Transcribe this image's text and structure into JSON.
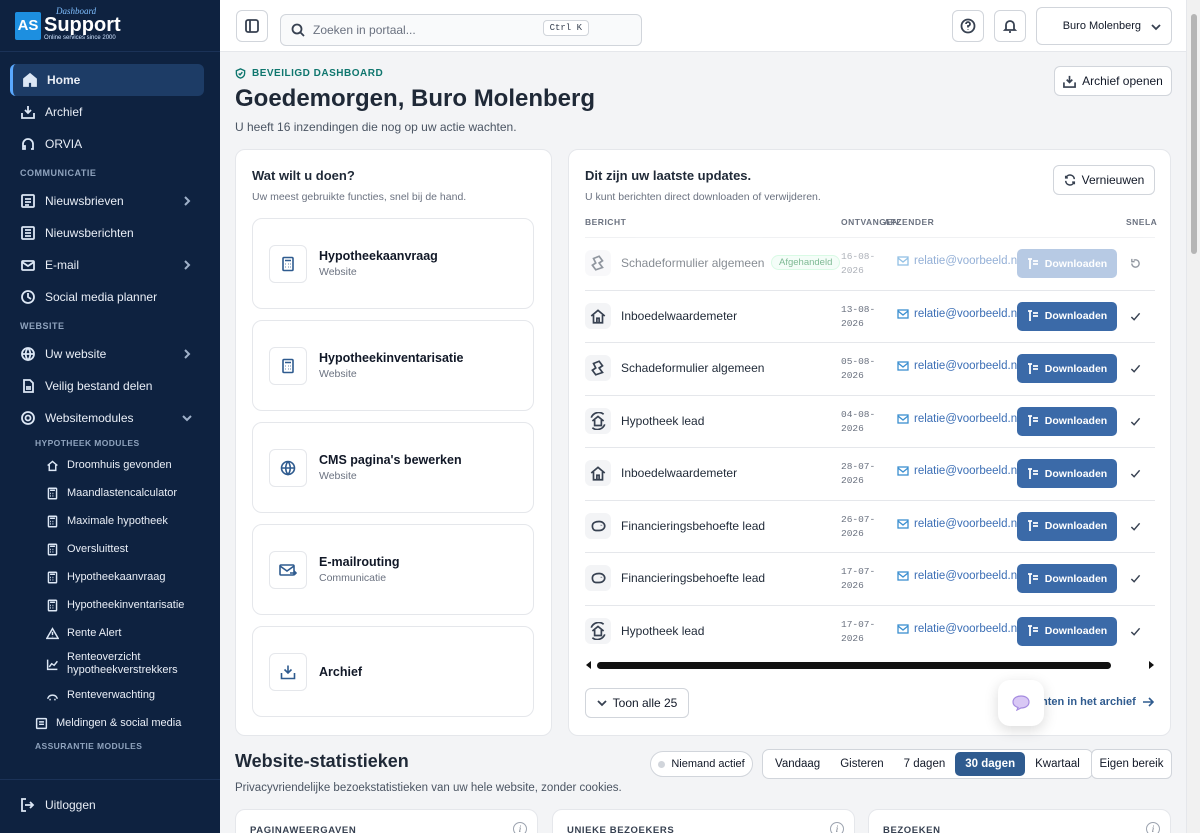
{
  "brand": {
    "logo_letters": "AS",
    "logo_small": "Dashboard",
    "logo_main": "Support",
    "logo_sub": "Online services since 2000"
  },
  "sidebar": {
    "items": [
      {
        "label": "Home"
      },
      {
        "label": "Archief"
      },
      {
        "label": "ORVIA"
      },
      {
        "section": "COMMUNICATIE"
      },
      {
        "label": "Nieuwsbrieven"
      },
      {
        "label": "Nieuwsberichten"
      },
      {
        "label": "E-mail"
      },
      {
        "label": "Social media planner"
      },
      {
        "section": "WEBSITE"
      },
      {
        "label": "Uw website"
      },
      {
        "label": "Veilig bestand delen"
      },
      {
        "label": "Websitemodules"
      }
    ],
    "hypotheek_section": "HYPOTHEEK MODULES",
    "hypotheek_items": [
      "Droomhuis gevonden",
      "Maandlastencalculator",
      "Maximale hypotheek",
      "Oversluittest",
      "Hypotheekaanvraag",
      "Hypotheekinventarisatie",
      "Rente Alert",
      "Renteoverzicht hypotheekverstrekkers",
      "Renteverwachting"
    ],
    "meldingen": "Meldingen & social media",
    "assurantie_section": "ASSURANTIE MODULES",
    "logout": "Uitloggen"
  },
  "topbar": {
    "search_placeholder": "Zoeken in portaal...",
    "shortcut": "Ctrl K",
    "account": "Buro Molenberg"
  },
  "header": {
    "eyebrow": "BEVEILIGD DASHBOARD",
    "title": "Goedemorgen, Buro Molenberg",
    "subtitle": "U heeft 16 inzendingen die nog op uw actie wachten.",
    "archive_button": "Archief openen"
  },
  "actions": {
    "title": "Wat wilt u doen?",
    "subtitle": "Uw meest gebruikte functies, snel bij de hand.",
    "tiles": [
      {
        "title": "Hypotheekaanvraag",
        "sub": "Website",
        "icon": "calculator-icon"
      },
      {
        "title": "Hypotheekinventarisatie",
        "sub": "Website",
        "icon": "calculator-icon"
      },
      {
        "title": "CMS pagina's bewerken",
        "sub": "Website",
        "icon": "globe-icon"
      },
      {
        "title": "E-mailrouting",
        "sub": "Communicatie",
        "icon": "mail-route-icon"
      },
      {
        "title": "Archief",
        "sub": "",
        "icon": "archive-icon"
      }
    ]
  },
  "updates": {
    "title": "Dit zijn uw laatste updates.",
    "subtitle": "U kunt berichten direct downloaden of verwijderen.",
    "refresh": "Vernieuwen",
    "headers": {
      "message": "BERICHT",
      "received": "ONTVANGEN",
      "sender": "AFZENDER",
      "quick": "SNELA"
    },
    "download_label": "Downloaden",
    "rows": [
      {
        "name": "Schadeformulier algemeen",
        "badge": "Afgehandeld",
        "date1": "16-08-",
        "date2": "2026",
        "email": "relatie@voorbeeld.nl",
        "icon": "damage-icon",
        "done": true
      },
      {
        "name": "Inboedelwaardemeter",
        "badge": "",
        "date1": "13-08-",
        "date2": "2026",
        "email": "relatie@voorbeeld.nl",
        "icon": "house-icon",
        "done": false
      },
      {
        "name": "Schadeformulier algemeen",
        "badge": "",
        "date1": "05-08-",
        "date2": "2026",
        "email": "relatie@voorbeeld.nl",
        "icon": "damage-icon",
        "done": false
      },
      {
        "name": "Hypotheek lead",
        "badge": "",
        "date1": "04-08-",
        "date2": "2026",
        "email": "relatie@voorbeeld.nl",
        "icon": "house-refresh-icon",
        "done": false
      },
      {
        "name": "Inboedelwaardemeter",
        "badge": "",
        "date1": "28-07-",
        "date2": "2026",
        "email": "relatie@voorbeeld.nl",
        "icon": "house-icon",
        "done": false
      },
      {
        "name": "Financieringsbehoefte lead",
        "badge": "",
        "date1": "26-07-",
        "date2": "2026",
        "email": "relatie@voorbeeld.nl",
        "icon": "piggy-bank-icon",
        "done": false
      },
      {
        "name": "Financieringsbehoefte lead",
        "badge": "",
        "date1": "17-07-",
        "date2": "2026",
        "email": "relatie@voorbeeld.nl",
        "icon": "piggy-bank-icon",
        "done": false
      },
      {
        "name": "Hypotheek lead",
        "badge": "",
        "date1": "17-07-",
        "date2": "2026",
        "email": "relatie@voorbeeld.nl",
        "icon": "house-refresh-icon",
        "done": false
      }
    ],
    "show_all": "Toon alle 25",
    "archive_link": "hten in het archief"
  },
  "stats": {
    "title": "Website-statistieken",
    "subtitle": "Privacyvriendelijke bezoekstatistieken van uw hele website, zonder cookies.",
    "live": "Niemand actief",
    "ranges": [
      "Vandaag",
      "Gisteren",
      "7 dagen",
      "30 dagen",
      "Kwartaal"
    ],
    "active_range": "30 dagen",
    "custom": "Eigen bereik",
    "cards": [
      "PAGINAWEERGAVEN",
      "UNIEKE BEZOEKERS",
      "BEZOEKEN"
    ]
  }
}
